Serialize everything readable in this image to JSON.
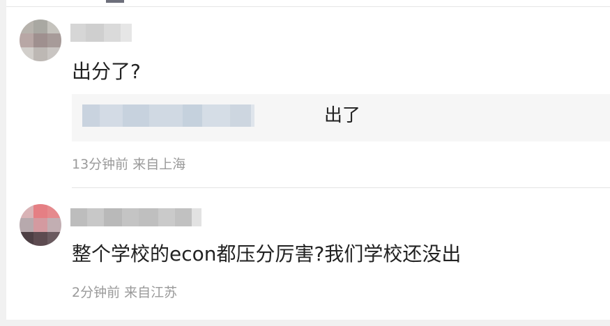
{
  "comments": [
    {
      "text": "出分了?",
      "reply": {
        "text": "出了"
      },
      "time": "13分钟前",
      "location": "来自上海"
    },
    {
      "text": "整个学校的econ都压分厉害?我们学校还没出",
      "time": "2分钟前",
      "location": "来自江苏"
    }
  ],
  "colors": {
    "meta_text": "#9a9a9a",
    "reply_bg": "#f6f6f6",
    "divider": "#e3e3e3"
  }
}
